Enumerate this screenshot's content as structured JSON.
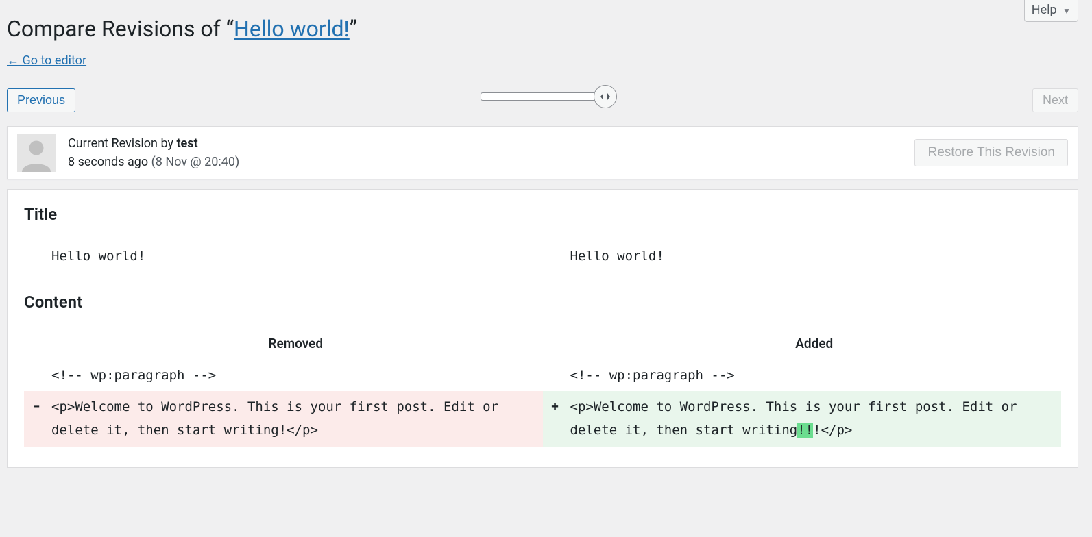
{
  "help": {
    "label": "Help"
  },
  "title": {
    "prefix": "Compare Revisions of “",
    "link": "Hello world!",
    "suffix": "”"
  },
  "back_link": "← Go to editor",
  "nav": {
    "prev": "Previous",
    "next": "Next"
  },
  "meta": {
    "line1_prefix": "Current Revision by ",
    "author": "test",
    "ago": "8 seconds ago ",
    "date": "(8 Nov @ 20:40)",
    "restore": "Restore This Revision"
  },
  "diff": {
    "title_heading": "Title",
    "title_left": "Hello world!",
    "title_right": "Hello world!",
    "content_heading": "Content",
    "removed_label": "Removed",
    "added_label": "Added",
    "ctx_left": "<!-- wp:paragraph -->",
    "ctx_right": "<!-- wp:paragraph -->",
    "removed_line": "<p>Welcome to WordPress. This is your first post. Edit or delete it, then start writing!</p>",
    "added_pre": "<p>Welcome to WordPress. This is your first post. Edit or delete it, then start writing",
    "added_hl": "!!",
    "added_post": "!</p>",
    "minus": "−",
    "plus": "+"
  }
}
